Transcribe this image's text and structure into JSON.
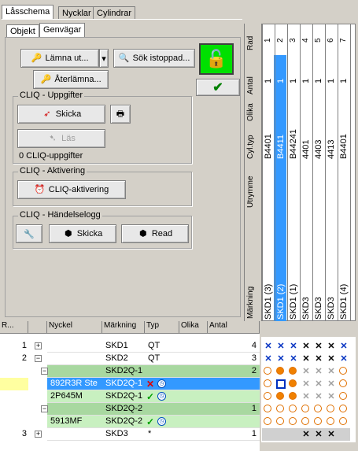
{
  "tabs_top": [
    "Låsschema",
    "Nycklar",
    "Cylindrar"
  ],
  "tabs_sub": [
    "Objekt",
    "Genvägar"
  ],
  "buttons": {
    "lamna_ut": "Lämna ut...",
    "sok": "Sök istoppad...",
    "aterlamna": "Återlämna...",
    "skicka": "Skicka",
    "las": "Läs",
    "cliq_akt": "CLIQ-aktivering",
    "skicka2": "Skicka",
    "read": "Read"
  },
  "groups": {
    "uppgifter": "CLIQ - Uppgifter",
    "aktivering": "CLIQ - Aktivering",
    "handelse": "CLIQ - Händelselogg"
  },
  "uppgifter_count": "0 CLIQ-uppgifter",
  "row_labels": [
    "Rad",
    "Antal",
    "Olika",
    "Cyl.typ",
    "Utrymme",
    "Märkning"
  ],
  "col_numbers": [
    "1",
    "2",
    "3",
    "4",
    "5",
    "6",
    "7"
  ],
  "antal_row": [
    "1",
    "1",
    "1",
    "1",
    "1",
    "1",
    "1"
  ],
  "cyltyp": [
    "B4401",
    "B4411",
    "B44241",
    "4401",
    "4403",
    "4413",
    "B4401"
  ],
  "markning": [
    "SKD1 (3)",
    "SKD1 (2)",
    "SKD1 (1)",
    "SKD3",
    "SKD3",
    "SKD3",
    "SKD1 (4)"
  ],
  "grid_headers": [
    "R...",
    "Nyckel",
    "Märkning",
    "Typ",
    "Olika",
    "Antal"
  ],
  "rows": [
    {
      "r": "1",
      "nyckel": "",
      "mark": "SKD1",
      "typ": "QT",
      "antal": "4"
    },
    {
      "r": "2",
      "nyckel": "",
      "mark": "SKD2",
      "typ": "QT",
      "antal": "3"
    },
    {
      "r": "",
      "nyckel": "",
      "mark": "SKD2Q-1",
      "typ": "",
      "antal": "2"
    },
    {
      "r": "",
      "nyckel": "892R3R  Ste",
      "mark": "SKD2Q-1",
      "typ": "",
      "antal": ""
    },
    {
      "r": "",
      "nyckel": "2P645M",
      "mark": "SKD2Q-1",
      "typ": "",
      "antal": ""
    },
    {
      "r": "",
      "nyckel": "",
      "mark": "SKD2Q-2",
      "typ": "",
      "antal": "1"
    },
    {
      "r": "",
      "nyckel": "5913MF",
      "mark": "SKD2Q-2",
      "typ": "",
      "antal": ""
    },
    {
      "r": "3",
      "nyckel": "",
      "mark": "SKD3",
      "typ": "*",
      "antal": "1"
    }
  ],
  "colors": {
    "accent": "#3399ff",
    "green_row": "#a8d8a0",
    "lock_bg": "#00e000"
  }
}
